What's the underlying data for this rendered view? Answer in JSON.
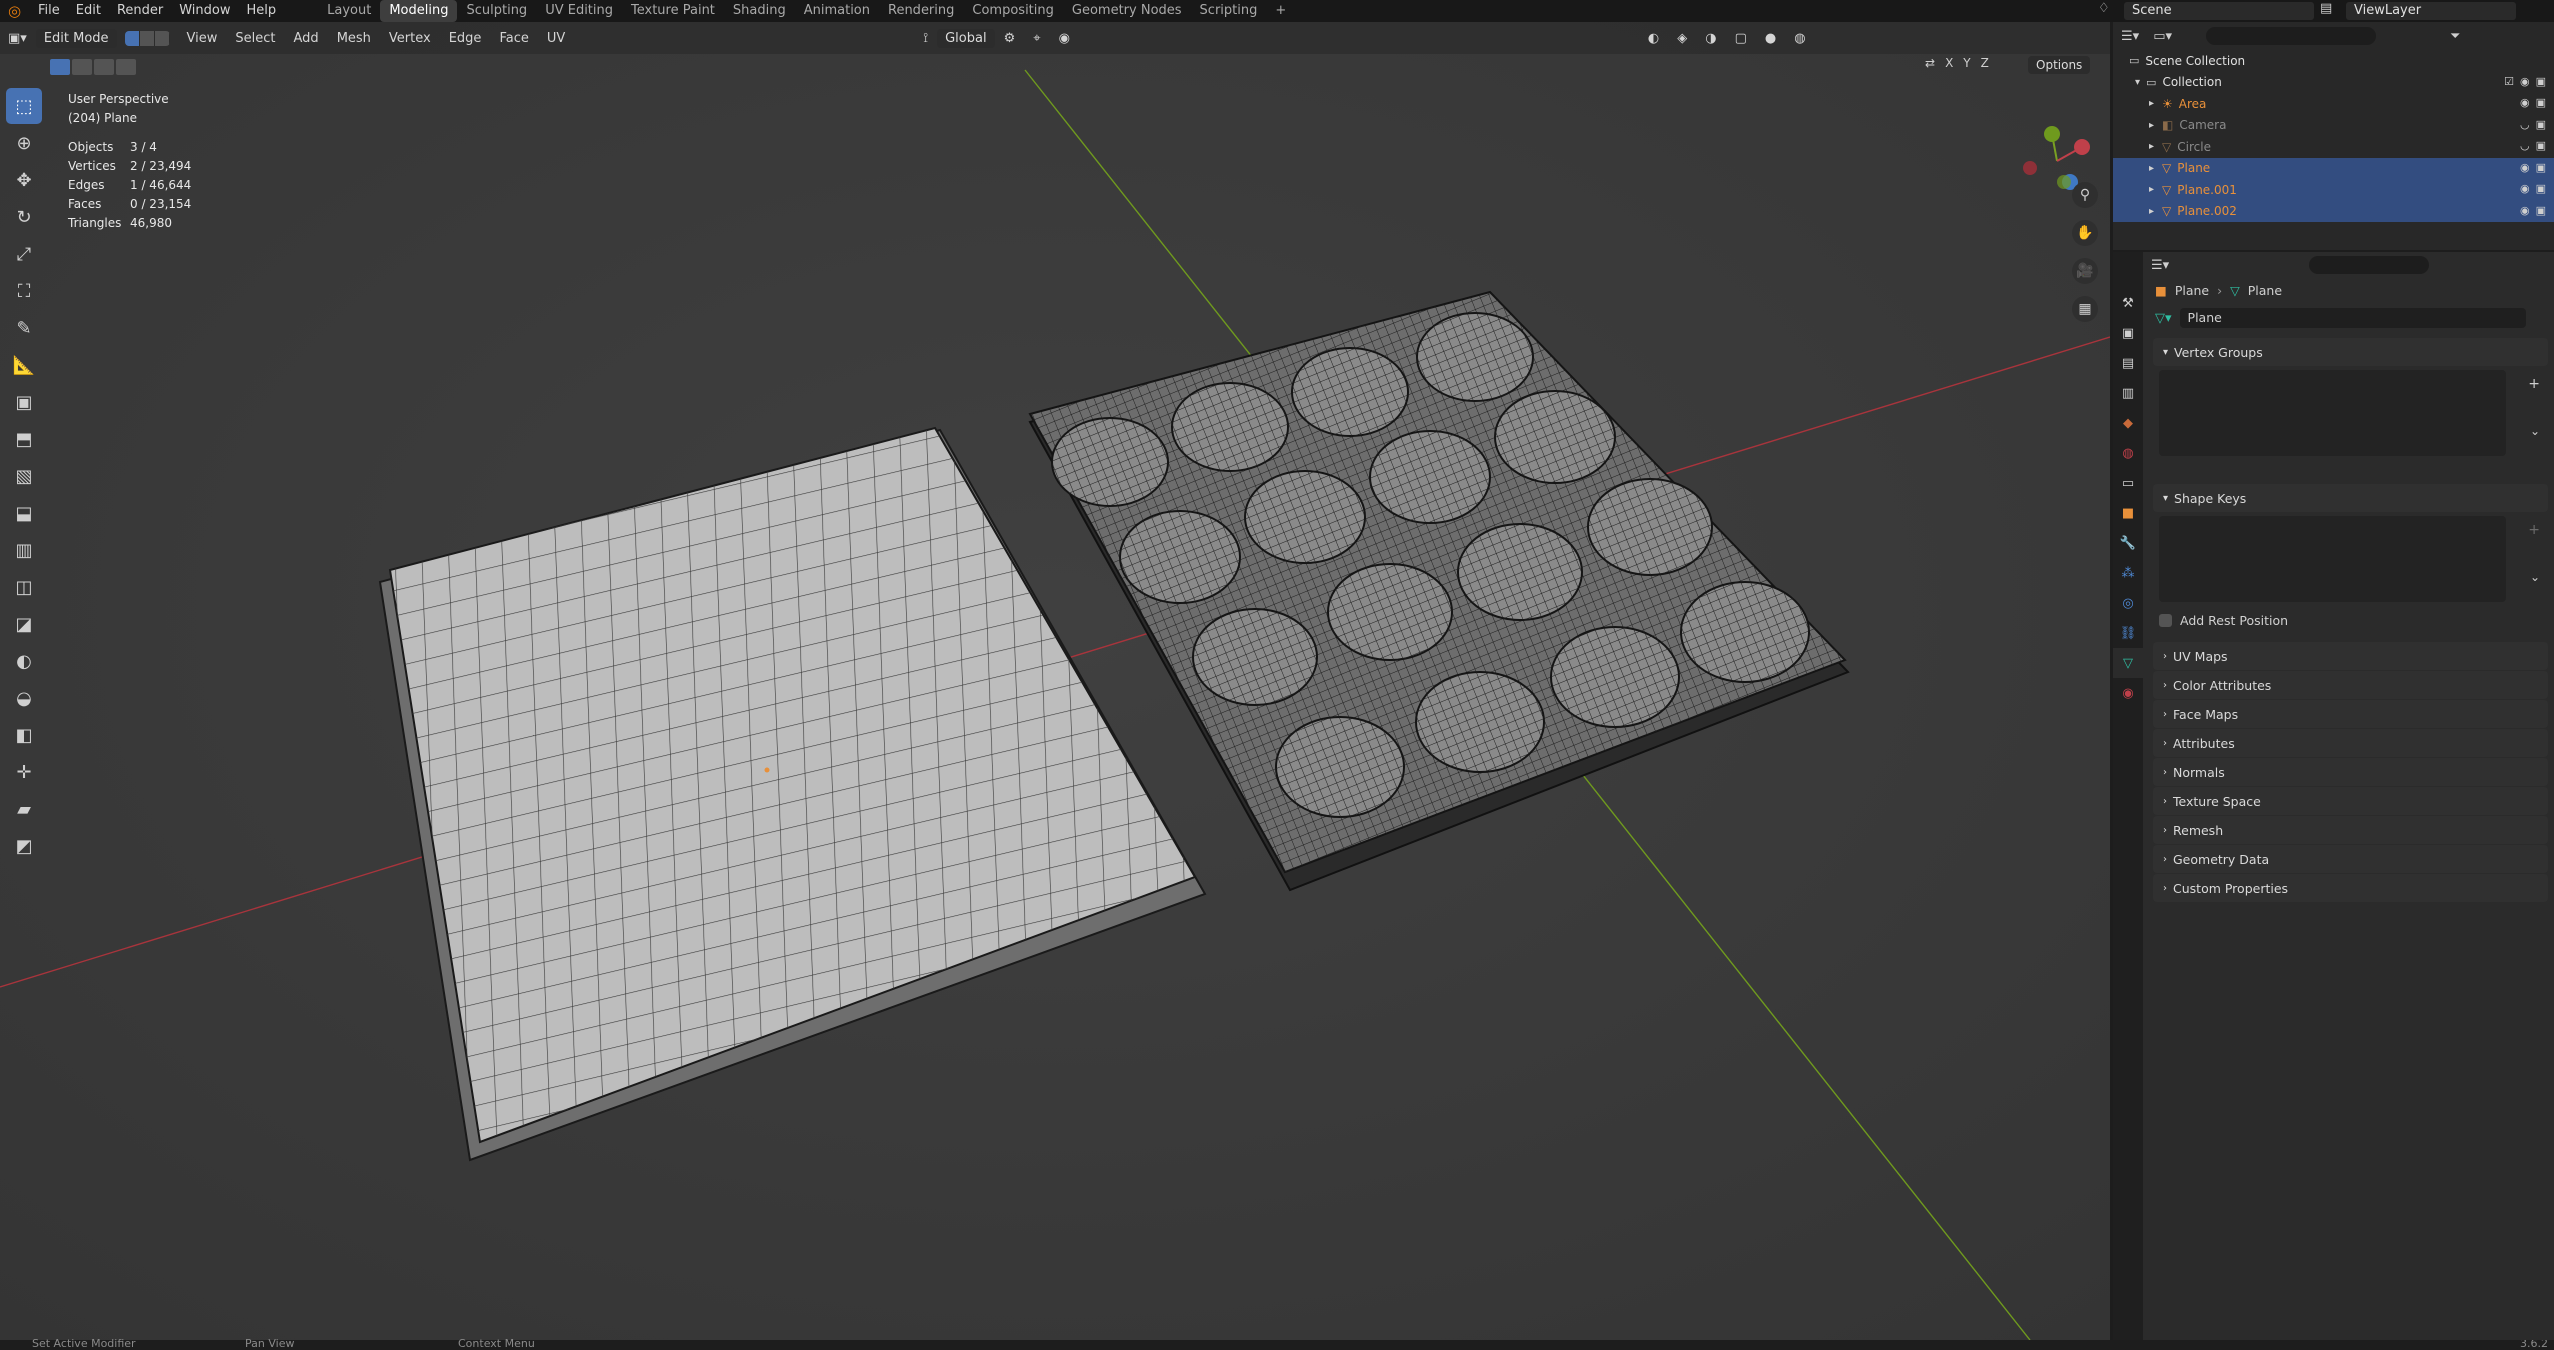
{
  "topbar": {
    "menus": [
      "File",
      "Edit",
      "Render",
      "Window",
      "Help"
    ],
    "workspaces": [
      "Layout",
      "Modeling",
      "Sculpting",
      "UV Editing",
      "Texture Paint",
      "Shading",
      "Animation",
      "Rendering",
      "Compositing",
      "Geometry Nodes",
      "Scripting",
      "+"
    ],
    "active_workspace": "Modeling",
    "scene": "Scene",
    "view_layer": "ViewLayer"
  },
  "viewport_header": {
    "mode": "Edit Mode",
    "menus": [
      "View",
      "Select",
      "Add",
      "Mesh",
      "Vertex",
      "Edge",
      "Face",
      "UV"
    ],
    "orientation": "Global",
    "options": "Options",
    "axes": [
      "X",
      "Y",
      "Z"
    ]
  },
  "overlay": {
    "perspective": "User Perspective",
    "object": "(204) Plane",
    "stats": [
      {
        "label": "Objects",
        "value": "3 / 4"
      },
      {
        "label": "Vertices",
        "value": "2 / 23,494"
      },
      {
        "label": "Edges",
        "value": "1 / 46,644"
      },
      {
        "label": "Faces",
        "value": "0 / 23,154"
      },
      {
        "label": "Triangles",
        "value": "46,980"
      }
    ]
  },
  "outliner": {
    "root": "Scene Collection",
    "collection": "Collection",
    "items": [
      {
        "name": "Area",
        "type": "light",
        "selected": false
      },
      {
        "name": "Camera",
        "type": "camera",
        "selected": false
      },
      {
        "name": "Circle",
        "type": "mesh",
        "selected": false
      },
      {
        "name": "Plane",
        "type": "mesh",
        "selected": true
      },
      {
        "name": "Plane.001",
        "type": "mesh",
        "selected": true
      },
      {
        "name": "Plane.002",
        "type": "mesh",
        "selected": true
      }
    ]
  },
  "properties": {
    "breadcrumb_object": "Plane",
    "breadcrumb_data": "Plane",
    "data_name": "Plane",
    "panels": {
      "vertex_groups": "Vertex Groups",
      "shape_keys": "Shape Keys",
      "add_rest_position": "Add Rest Position"
    },
    "collapsed_panels": [
      "UV Maps",
      "Color Attributes",
      "Face Maps",
      "Attributes",
      "Normals",
      "Texture Space",
      "Remesh",
      "Geometry Data",
      "Custom Properties"
    ]
  },
  "statusbar": {
    "items": [
      "Set Active Modifier",
      "Pan View",
      "Context Menu"
    ],
    "version": "3.6.2"
  },
  "colors": {
    "accent": "#4772b3",
    "object_orange": "#e8903a",
    "x_axis": "#b0353f",
    "y_axis": "#7aa022"
  }
}
